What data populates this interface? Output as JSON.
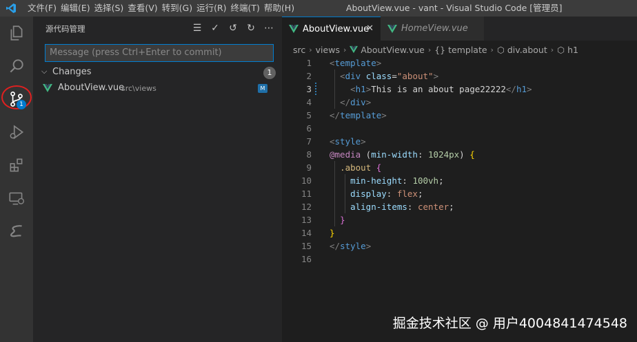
{
  "window": {
    "title": "AboutView.vue - vant - Visual Studio Code [管理员]",
    "menu": [
      "文件(F)",
      "编辑(E)",
      "选择(S)",
      "查看(V)",
      "转到(G)",
      "运行(R)",
      "终端(T)",
      "帮助(H)"
    ]
  },
  "activity_bar": {
    "items": [
      "explorer-icon",
      "search-icon",
      "source-control-icon",
      "run-debug-icon",
      "extensions-icon",
      "remote-explorer-icon",
      "stylus-icon"
    ],
    "source_control_badge": "1"
  },
  "sidebar": {
    "title": "源代码管理",
    "actions": [
      "view-as-tree-icon",
      "commit-check-icon",
      "history-icon",
      "refresh-icon",
      "more-actions-icon"
    ],
    "message_placeholder": "Message (press Ctrl+Enter to commit)",
    "changes_label": "Changes",
    "changes_count": "1",
    "files": [
      {
        "name": "AboutView.vue",
        "path": "src\\views",
        "status": "M"
      }
    ]
  },
  "editor": {
    "tabs": [
      {
        "label": "AboutView.vue",
        "active": true
      },
      {
        "label": "HomeView.vue",
        "active": false
      }
    ],
    "breadcrumb": [
      "src",
      "views",
      "AboutView.vue",
      "{} template",
      "div.about",
      "h1"
    ],
    "current_line": 3,
    "lines": [
      {
        "n": "1",
        "tokens": [
          [
            "<",
            "#808080"
          ],
          [
            "template",
            "#569cd6"
          ],
          [
            ">",
            "#808080"
          ]
        ]
      },
      {
        "n": "2",
        "tokens": [
          [
            "  ",
            ""
          ],
          [
            "<",
            "#808080"
          ],
          [
            "div",
            "#569cd6"
          ],
          [
            " ",
            ""
          ],
          [
            "class",
            "#9cdcfe"
          ],
          [
            "=",
            "#d4d4d4"
          ],
          [
            "\"about\"",
            "#ce9178"
          ],
          [
            ">",
            "#808080"
          ]
        ]
      },
      {
        "n": "3",
        "tokens": [
          [
            "    ",
            ""
          ],
          [
            "<",
            "#808080"
          ],
          [
            "h1",
            "#569cd6"
          ],
          [
            ">",
            "#808080"
          ],
          [
            "This is an about page22222",
            "#d4d4d4"
          ],
          [
            "</",
            "#808080"
          ],
          [
            "h1",
            "#569cd6"
          ],
          [
            ">",
            "#808080"
          ]
        ]
      },
      {
        "n": "4",
        "tokens": [
          [
            "  ",
            ""
          ],
          [
            "</",
            "#808080"
          ],
          [
            "div",
            "#569cd6"
          ],
          [
            ">",
            "#808080"
          ]
        ]
      },
      {
        "n": "5",
        "tokens": [
          [
            "</",
            "#808080"
          ],
          [
            "template",
            "#569cd6"
          ],
          [
            ">",
            "#808080"
          ]
        ]
      },
      {
        "n": "6",
        "tokens": []
      },
      {
        "n": "7",
        "tokens": [
          [
            "<",
            "#808080"
          ],
          [
            "style",
            "#569cd6"
          ],
          [
            ">",
            "#808080"
          ]
        ]
      },
      {
        "n": "8",
        "tokens": [
          [
            "@media",
            "#c586c0"
          ],
          [
            " (",
            "#d4d4d4"
          ],
          [
            "min-width",
            "#9cdcfe"
          ],
          [
            ": ",
            "#d4d4d4"
          ],
          [
            "1024px",
            "#b5cea8"
          ],
          [
            ") ",
            "#d4d4d4"
          ],
          [
            "{",
            "#ffd700"
          ]
        ]
      },
      {
        "n": "9",
        "tokens": [
          [
            "  ",
            ""
          ],
          [
            ".about",
            "#d7ba7d"
          ],
          [
            " ",
            ""
          ],
          [
            "{",
            "#da70d6"
          ]
        ]
      },
      {
        "n": "10",
        "tokens": [
          [
            "    ",
            ""
          ],
          [
            "min-height",
            "#9cdcfe"
          ],
          [
            ": ",
            "#d4d4d4"
          ],
          [
            "100vh",
            "#b5cea8"
          ],
          [
            ";",
            "#d4d4d4"
          ]
        ]
      },
      {
        "n": "11",
        "tokens": [
          [
            "    ",
            ""
          ],
          [
            "display",
            "#9cdcfe"
          ],
          [
            ": ",
            "#d4d4d4"
          ],
          [
            "flex",
            "#ce9178"
          ],
          [
            ";",
            "#d4d4d4"
          ]
        ]
      },
      {
        "n": "12",
        "tokens": [
          [
            "    ",
            ""
          ],
          [
            "align-items",
            "#9cdcfe"
          ],
          [
            ": ",
            "#d4d4d4"
          ],
          [
            "center",
            "#ce9178"
          ],
          [
            ";",
            "#d4d4d4"
          ]
        ]
      },
      {
        "n": "13",
        "tokens": [
          [
            "  ",
            ""
          ],
          [
            "}",
            "#da70d6"
          ]
        ]
      },
      {
        "n": "14",
        "tokens": [
          [
            "}",
            "#ffd700"
          ]
        ]
      },
      {
        "n": "15",
        "tokens": [
          [
            "</",
            "#808080"
          ],
          [
            "style",
            "#569cd6"
          ],
          [
            ">",
            "#808080"
          ]
        ]
      },
      {
        "n": "16",
        "tokens": []
      }
    ]
  },
  "watermark": "掘金技术社区 @ 用户4004841474548",
  "colors": {
    "accent": "#007acc",
    "vue_green": "#41b883",
    "annotation_red": "#e02020"
  }
}
